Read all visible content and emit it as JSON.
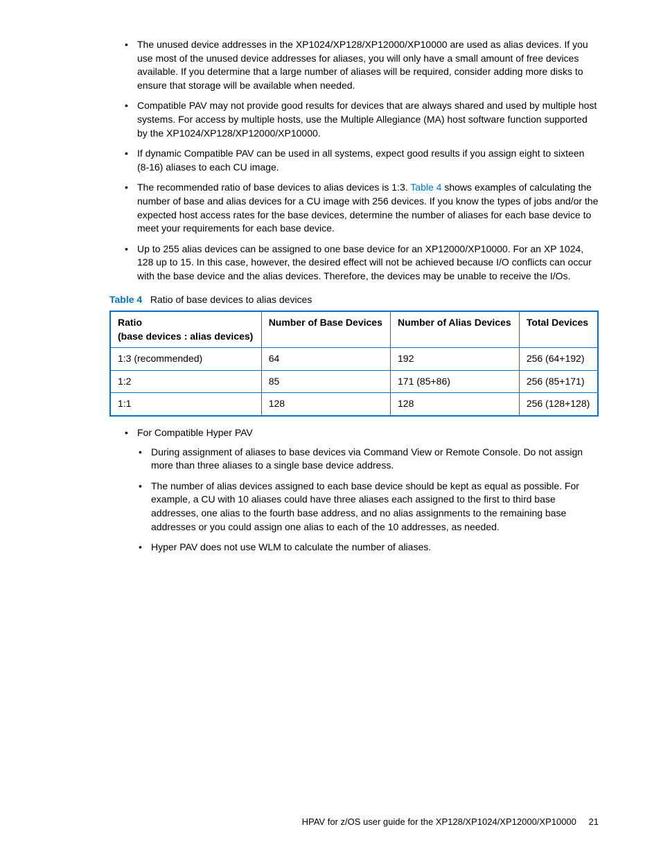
{
  "bullets_top": [
    "The unused device addresses in the XP1024/XP128/XP12000/XP10000 are used as alias devices. If you use most of the unused device addresses for aliases, you will only have a small amount of free devices available. If you determine that a large number of aliases will be required, consider adding more disks to ensure that storage will be available when needed.",
    "Compatible PAV may not provide good results for devices that are always shared and used by multiple host systems. For access by multiple hosts, use the Multiple Allegiance (MA) host software function supported by the XP1024/XP128/XP12000/XP10000.",
    "If dynamic Compatible PAV can be used in all systems, expect good results if you assign eight to sixteen (8-16) aliases to each CU image."
  ],
  "bullet_ratio_pre": "The recommended ratio of base devices to alias devices is 1:3. ",
  "bullet_ratio_link": "Table 4",
  "bullet_ratio_post": " shows examples of calculating the number of base and alias devices for a CU image with 256 devices. If you know the types of jobs and/or the expected host access rates for the base devices, determine the number of aliases for each base device to meet your requirements for each base device.",
  "bullet_255": "Up to 255 alias devices can be assigned to one base device for an XP12000/XP10000. For an XP 1024, 128 up to 15. In this case, however, the desired effect will not be achieved because I/O conflicts can occur with the base device and the alias devices. Therefore, the devices may be unable to receive the I/Os.",
  "table_caption_label": "Table 4",
  "table_caption_text": "Ratio of base devices to alias devices",
  "table": {
    "headers": {
      "ratio_line1": "Ratio",
      "ratio_line2": "(base devices : alias devices)",
      "base": "Number of Base Devices",
      "alias": "Number of Alias Devices",
      "total": "Total Devices"
    },
    "rows": [
      {
        "ratio": "1:3 (recommended)",
        "base": "64",
        "alias": "192",
        "total": "256 (64+192)"
      },
      {
        "ratio": "1:2",
        "base": "85",
        "alias": "171 (85+86)",
        "total": "256 (85+171)"
      },
      {
        "ratio": "1:1",
        "base": "128",
        "alias": "128",
        "total": "256 (128+128)"
      }
    ]
  },
  "hyper_title": "For Compatible Hyper PAV",
  "hyper_bullets": [
    "During assignment of aliases to base devices via Command View or Remote Console. Do not assign more than three aliases to a single base device address.",
    "The number of alias devices assigned to each base device should be kept as equal as possible. For example, a CU with 10 aliases could have three aliases each assigned to the first to third base addresses, one alias to the fourth base address, and no alias assignments to the remaining base addresses or you could assign one alias to each of the 10 addresses, as needed.",
    "Hyper PAV does not use WLM to calculate the number of aliases."
  ],
  "footer_text": "HPAV for z/OS user guide for the XP128/XP1024/XP12000/XP10000",
  "page_number": "21"
}
